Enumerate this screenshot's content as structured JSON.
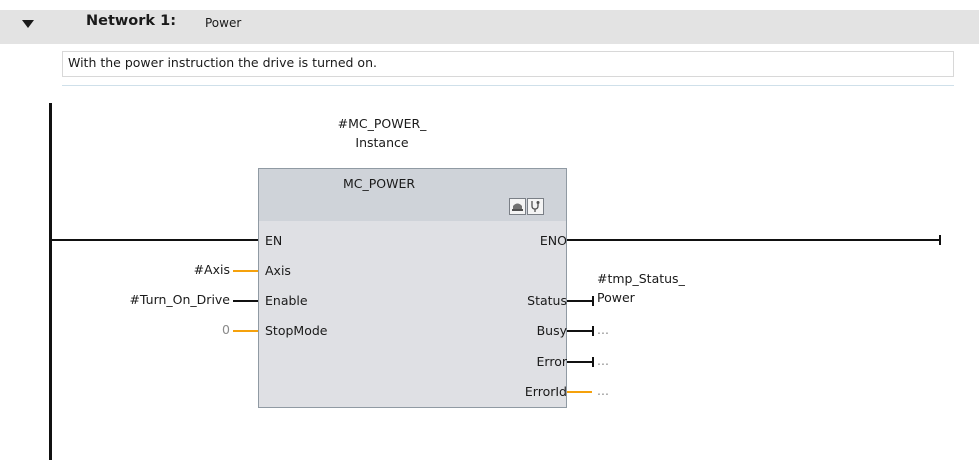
{
  "network": {
    "title": "Network 1:",
    "name": "Power",
    "comment": "With the power instruction the drive is turned on."
  },
  "block": {
    "instance_line1": "#MC_POWER_",
    "instance_line2": "Instance",
    "name": "MC_POWER",
    "icons": [
      "block-edit-icon",
      "stethoscope-icon"
    ],
    "inputs": [
      "EN",
      "Axis",
      "Enable",
      "StopMode"
    ],
    "outputs": [
      "ENO",
      "Status",
      "Busy",
      "Error",
      "ErrorId"
    ]
  },
  "operands": {
    "axis": "#Axis",
    "enable": "#Turn_On_Drive",
    "stopmode": "0",
    "status_line1": "#tmp_Status_",
    "status_line2": "Power",
    "busy": "...",
    "error": "...",
    "errorid": "..."
  },
  "colors": {
    "header_bg": "#e3e3e3",
    "block_bg": "#dfe0e4",
    "block_header_bg": "#cfd3d9",
    "wire": "#111111",
    "orange_wire": "#f5a10c"
  }
}
